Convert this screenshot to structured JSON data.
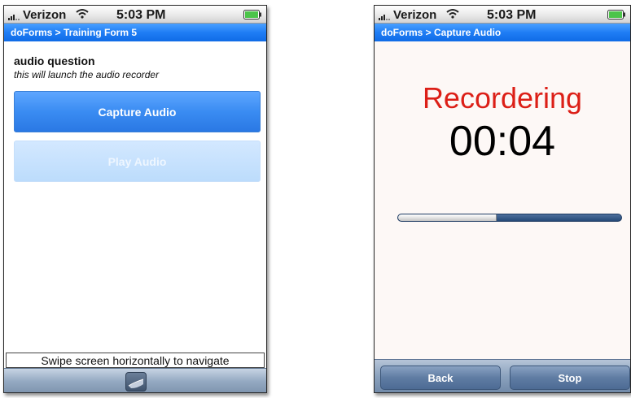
{
  "left_screen": {
    "status_bar": {
      "carrier": "Verizon",
      "time": "5:03 PM"
    },
    "nav_title": "doForms > Training Form 5",
    "question": {
      "title": "audio question",
      "hint": "this will launch the audio recorder"
    },
    "buttons": {
      "capture": "Capture Audio",
      "play": "Play Audio"
    },
    "swipe_hint": "Swipe screen horizontally to navigate"
  },
  "right_screen": {
    "status_bar": {
      "carrier": "Verizon",
      "time": "5:03 PM"
    },
    "nav_title": "doForms > Capture Audio",
    "recording_status": "Recordering",
    "timer": "00:04",
    "progress": 0.44,
    "toolbar": {
      "back": "Back",
      "stop": "Stop"
    }
  },
  "colors": {
    "nav_blue": "#1f7df5",
    "recording_red": "#dc1f17"
  }
}
